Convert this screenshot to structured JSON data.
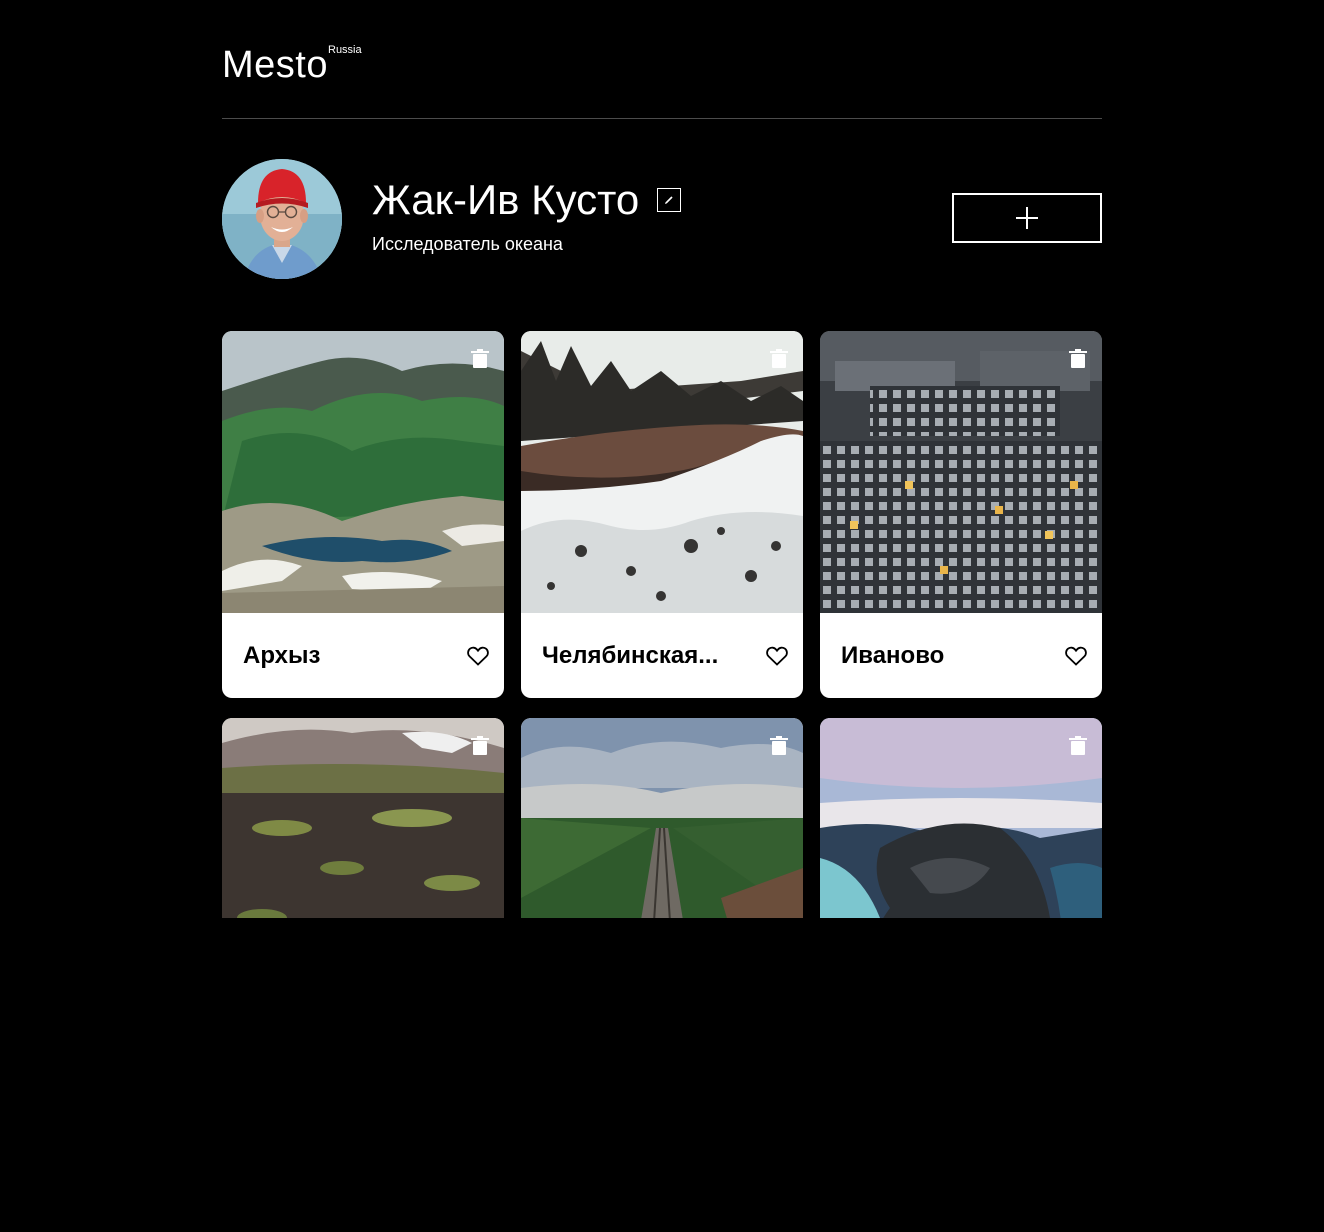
{
  "header": {
    "logo_text": "Mesto",
    "logo_sup": "Russia"
  },
  "profile": {
    "name": "Жак-Ив Кусто",
    "about": "Исследователь океана",
    "avatar_icon": "avatar-photo",
    "edit_icon": "pencil-icon",
    "add_icon": "plus-icon"
  },
  "colors": {
    "background": "#000000",
    "text": "#ffffff",
    "card_background": "#ffffff",
    "card_text": "#000000",
    "divider": "#545454"
  },
  "cards": [
    {
      "title": "Архыз",
      "scene": "mountains-green"
    },
    {
      "title": "Челябинская...",
      "scene": "snow-river"
    },
    {
      "title": "Иваново",
      "scene": "city-buildings"
    },
    {
      "title": "",
      "scene": "tundra-volcano"
    },
    {
      "title": "",
      "scene": "forest-railway"
    },
    {
      "title": "",
      "scene": "lake-rocks"
    }
  ]
}
